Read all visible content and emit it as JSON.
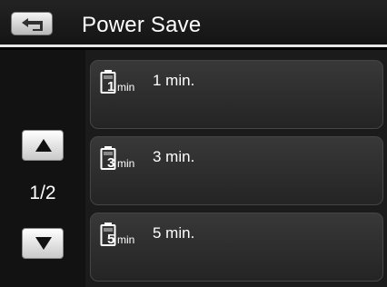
{
  "header": {
    "title": "Power Save",
    "back_icon": "back-icon"
  },
  "pager": {
    "page_indicator": "1/2",
    "up_icon": "arrow-up-icon",
    "down_icon": "arrow-down-icon"
  },
  "options": [
    {
      "icon": "battery-timer-icon",
      "icon_number": "1",
      "icon_unit": "min",
      "label": "1 min."
    },
    {
      "icon": "battery-timer-icon",
      "icon_number": "3",
      "icon_unit": "min",
      "label": "3 min."
    },
    {
      "icon": "battery-timer-icon",
      "icon_number": "5",
      "icon_unit": "min",
      "label": "5 min."
    }
  ]
}
